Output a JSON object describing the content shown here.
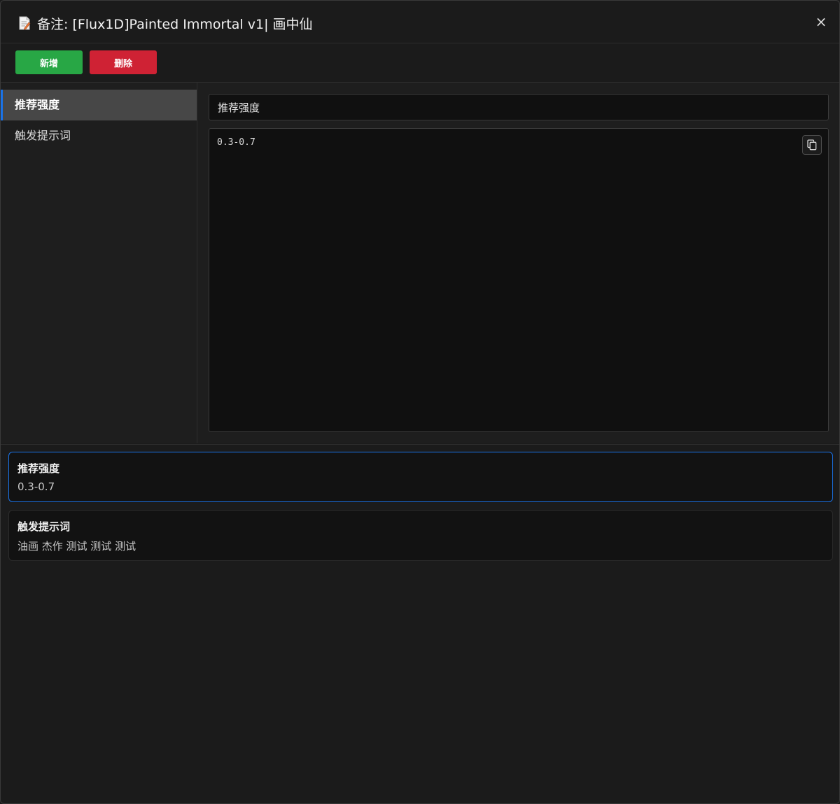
{
  "dialog": {
    "title": "备注: [Flux1D]Painted Immortal v1| 画中仙",
    "title_icon": "note-icon",
    "close_label": "×",
    "close_icon": "close-icon"
  },
  "toolbar": {
    "add_label": "新增",
    "add_color": "#28a745",
    "delete_label": "删除",
    "delete_color": "#cf2234"
  },
  "sidebar": {
    "items": [
      {
        "label": "推荐强度",
        "active": true
      },
      {
        "label": "触发提示词",
        "active": false
      }
    ]
  },
  "editor": {
    "title_value": "推荐强度",
    "content_value": "0.3-0.7",
    "copy_icon": "copy-icon"
  },
  "notes": [
    {
      "title": "推荐强度",
      "body": "0.3-0.7",
      "selected": true
    },
    {
      "title": "触发提示词",
      "body": "油画 杰作 测试 测试 测试",
      "selected": false
    }
  ],
  "colors": {
    "accent": "#1a73e8",
    "background": "#1b1b1b"
  }
}
